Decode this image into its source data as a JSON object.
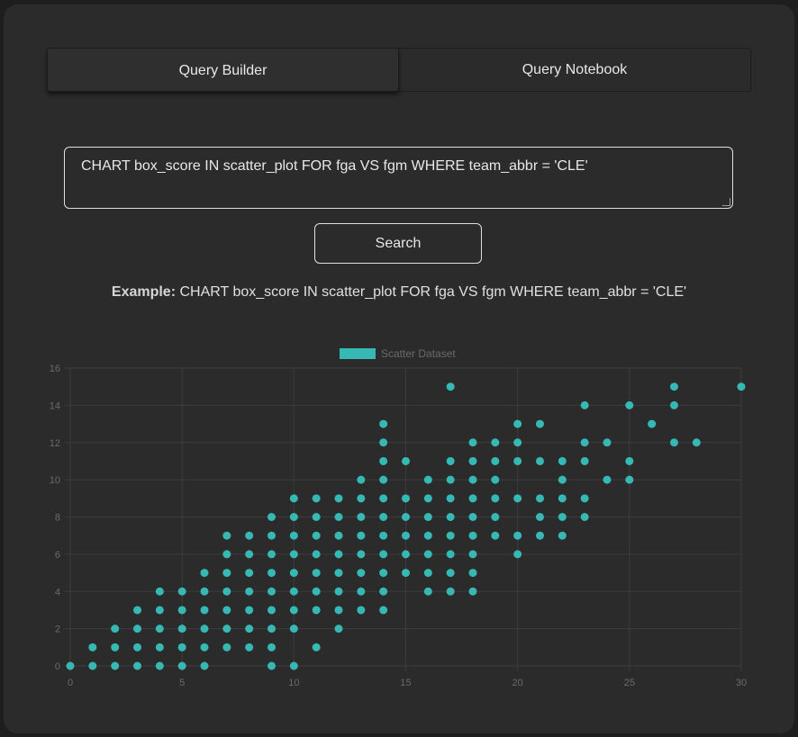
{
  "tabs": [
    {
      "label": "Query Builder",
      "active": true
    },
    {
      "label": "Query Notebook",
      "active": false
    }
  ],
  "query": {
    "value": "CHART box_score IN scatter_plot FOR fga VS fgm WHERE team_abbr = 'CLE'"
  },
  "search_button": {
    "label": "Search"
  },
  "example": {
    "label": "Example:",
    "text": "CHART box_score IN scatter_plot FOR fga VS fgm WHERE team_abbr = 'CLE'"
  },
  "colors": {
    "point": "#36b9b4",
    "grid": "#3c3c3c",
    "tick_text": "#6b6b6b"
  },
  "chart_data": {
    "type": "scatter",
    "legend": {
      "label": "Scatter Dataset",
      "placement": "top-center"
    },
    "xlim": [
      0,
      30
    ],
    "ylim": [
      0,
      16
    ],
    "xticks": [
      0,
      5,
      10,
      15,
      20,
      25,
      30
    ],
    "yticks": [
      0,
      2,
      4,
      6,
      8,
      10,
      12,
      14,
      16
    ],
    "grid": true,
    "points": [
      [
        0,
        0
      ],
      [
        1,
        0
      ],
      [
        2,
        0
      ],
      [
        3,
        0
      ],
      [
        4,
        0
      ],
      [
        5,
        0
      ],
      [
        6,
        0
      ],
      [
        9,
        0
      ],
      [
        10,
        0
      ],
      [
        1,
        1
      ],
      [
        2,
        1
      ],
      [
        3,
        1
      ],
      [
        4,
        1
      ],
      [
        5,
        1
      ],
      [
        6,
        1
      ],
      [
        7,
        1
      ],
      [
        8,
        1
      ],
      [
        9,
        1
      ],
      [
        11,
        1
      ],
      [
        2,
        2
      ],
      [
        3,
        2
      ],
      [
        4,
        2
      ],
      [
        5,
        2
      ],
      [
        6,
        2
      ],
      [
        7,
        2
      ],
      [
        8,
        2
      ],
      [
        9,
        2
      ],
      [
        10,
        2
      ],
      [
        12,
        2
      ],
      [
        3,
        3
      ],
      [
        4,
        3
      ],
      [
        5,
        3
      ],
      [
        6,
        3
      ],
      [
        7,
        3
      ],
      [
        8,
        3
      ],
      [
        9,
        3
      ],
      [
        10,
        3
      ],
      [
        11,
        3
      ],
      [
        12,
        3
      ],
      [
        13,
        3
      ],
      [
        14,
        3
      ],
      [
        4,
        4
      ],
      [
        5,
        4
      ],
      [
        6,
        4
      ],
      [
        7,
        4
      ],
      [
        8,
        4
      ],
      [
        9,
        4
      ],
      [
        10,
        4
      ],
      [
        11,
        4
      ],
      [
        12,
        4
      ],
      [
        13,
        4
      ],
      [
        14,
        4
      ],
      [
        16,
        4
      ],
      [
        17,
        4
      ],
      [
        18,
        4
      ],
      [
        6,
        5
      ],
      [
        7,
        5
      ],
      [
        8,
        5
      ],
      [
        9,
        5
      ],
      [
        10,
        5
      ],
      [
        11,
        5
      ],
      [
        12,
        5
      ],
      [
        13,
        5
      ],
      [
        14,
        5
      ],
      [
        15,
        5
      ],
      [
        16,
        5
      ],
      [
        17,
        5
      ],
      [
        18,
        5
      ],
      [
        7,
        6
      ],
      [
        8,
        6
      ],
      [
        9,
        6
      ],
      [
        10,
        6
      ],
      [
        11,
        6
      ],
      [
        12,
        6
      ],
      [
        13,
        6
      ],
      [
        14,
        6
      ],
      [
        15,
        6
      ],
      [
        16,
        6
      ],
      [
        17,
        6
      ],
      [
        18,
        6
      ],
      [
        20,
        6
      ],
      [
        7,
        7
      ],
      [
        8,
        7
      ],
      [
        9,
        7
      ],
      [
        10,
        7
      ],
      [
        11,
        7
      ],
      [
        12,
        7
      ],
      [
        13,
        7
      ],
      [
        14,
        7
      ],
      [
        15,
        7
      ],
      [
        16,
        7
      ],
      [
        17,
        7
      ],
      [
        18,
        7
      ],
      [
        19,
        7
      ],
      [
        20,
        7
      ],
      [
        21,
        7
      ],
      [
        22,
        7
      ],
      [
        9,
        8
      ],
      [
        10,
        8
      ],
      [
        11,
        8
      ],
      [
        12,
        8
      ],
      [
        13,
        8
      ],
      [
        14,
        8
      ],
      [
        15,
        8
      ],
      [
        16,
        8
      ],
      [
        17,
        8
      ],
      [
        18,
        8
      ],
      [
        19,
        8
      ],
      [
        21,
        8
      ],
      [
        22,
        8
      ],
      [
        23,
        8
      ],
      [
        10,
        9
      ],
      [
        11,
        9
      ],
      [
        12,
        9
      ],
      [
        13,
        9
      ],
      [
        14,
        9
      ],
      [
        15,
        9
      ],
      [
        16,
        9
      ],
      [
        17,
        9
      ],
      [
        18,
        9
      ],
      [
        19,
        9
      ],
      [
        20,
        9
      ],
      [
        21,
        9
      ],
      [
        22,
        9
      ],
      [
        23,
        9
      ],
      [
        13,
        10
      ],
      [
        14,
        10
      ],
      [
        16,
        10
      ],
      [
        17,
        10
      ],
      [
        18,
        10
      ],
      [
        19,
        10
      ],
      [
        22,
        10
      ],
      [
        24,
        10
      ],
      [
        25,
        10
      ],
      [
        14,
        11
      ],
      [
        15,
        11
      ],
      [
        17,
        11
      ],
      [
        18,
        11
      ],
      [
        19,
        11
      ],
      [
        20,
        11
      ],
      [
        21,
        11
      ],
      [
        22,
        11
      ],
      [
        23,
        11
      ],
      [
        25,
        11
      ],
      [
        14,
        12
      ],
      [
        18,
        12
      ],
      [
        19,
        12
      ],
      [
        20,
        12
      ],
      [
        23,
        12
      ],
      [
        24,
        12
      ],
      [
        27,
        12
      ],
      [
        28,
        12
      ],
      [
        14,
        13
      ],
      [
        20,
        13
      ],
      [
        21,
        13
      ],
      [
        26,
        13
      ],
      [
        23,
        14
      ],
      [
        25,
        14
      ],
      [
        27,
        14
      ],
      [
        17,
        15
      ],
      [
        27,
        15
      ],
      [
        30,
        15
      ]
    ]
  }
}
